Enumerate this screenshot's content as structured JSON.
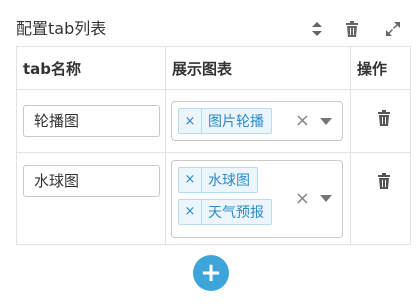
{
  "header": {
    "title": "配置tab列表"
  },
  "table": {
    "columns": [
      "tab名称",
      "展示图表",
      "操作"
    ],
    "rows": [
      {
        "name": "轮播图",
        "charts": [
          "图片轮播"
        ]
      },
      {
        "name": "水球图",
        "charts": [
          "水球图",
          "天气预报"
        ]
      }
    ]
  },
  "icons": {
    "sort": "sort-icon",
    "delete": "trash-icon",
    "expand": "expand-icon",
    "tag_remove": "×",
    "clear": "×",
    "add": "+"
  },
  "colors": {
    "accent": "#3ea5db",
    "tag_text": "#2a8bc7",
    "tag_bg": "#ebf5fb",
    "border": "#e2e2e2"
  }
}
